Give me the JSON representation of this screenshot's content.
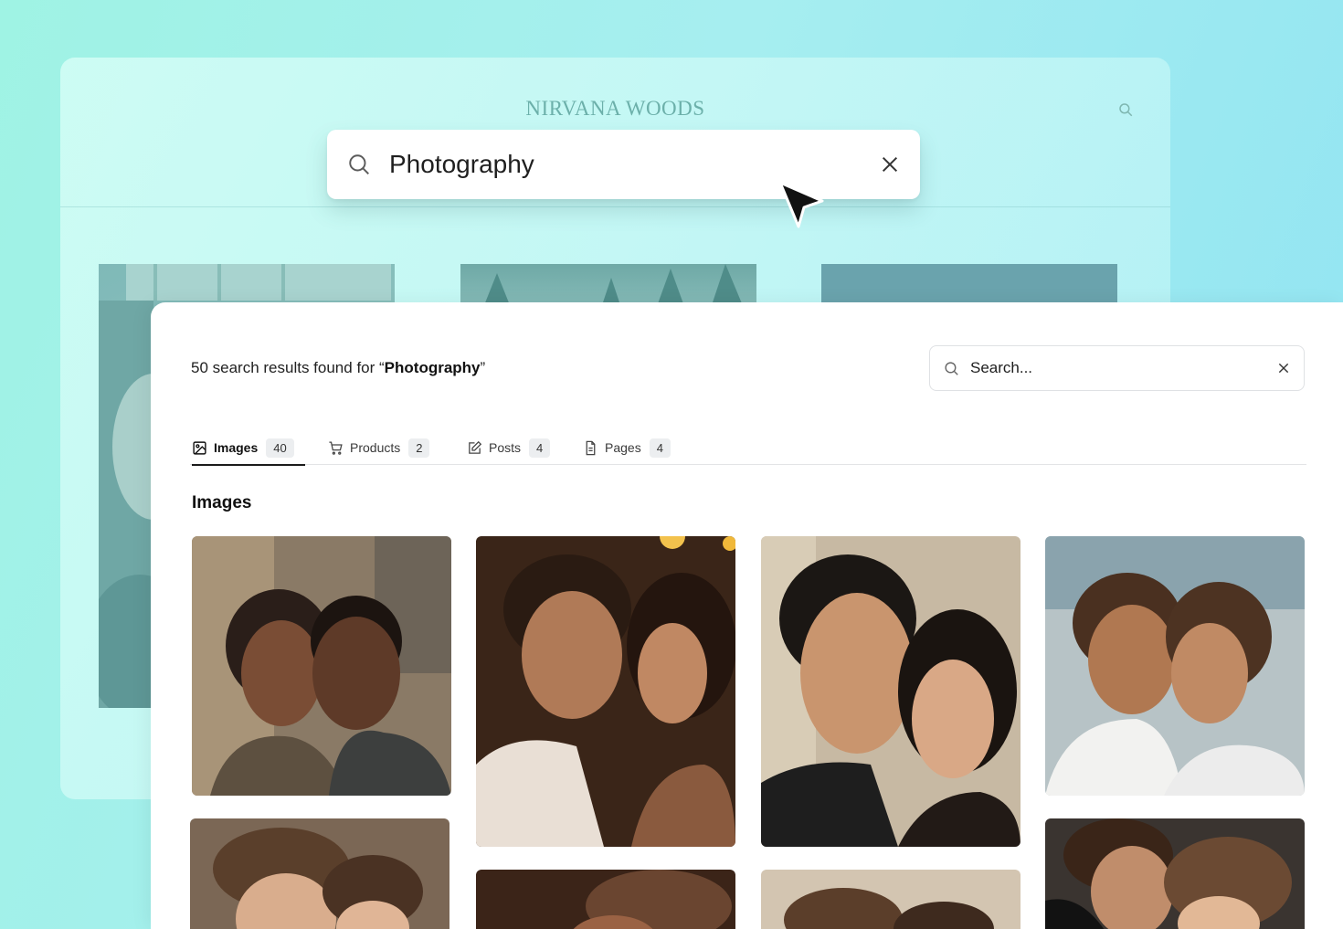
{
  "background_site": {
    "brand": "NIRVANA WOODS"
  },
  "hero_search": {
    "query": "Photography"
  },
  "results": {
    "prefix": "50 search results found for “",
    "query": "Photography",
    "suffix": "”",
    "search_placeholder": "Search..."
  },
  "tabs": [
    {
      "label": "Images",
      "count": "40",
      "icon": "image-icon",
      "active": true
    },
    {
      "label": "Products",
      "count": "2",
      "icon": "cart-icon",
      "active": false
    },
    {
      "label": "Posts",
      "count": "4",
      "icon": "edit-icon",
      "active": false
    },
    {
      "label": "Pages",
      "count": "4",
      "icon": "document-icon",
      "active": false
    }
  ],
  "section_title": "Images",
  "colors": {
    "background_start": "#9ff3e4",
    "background_end": "#8fe3f2",
    "brand": "#6cb0aa",
    "active_tab_underline": "#1b1b1b"
  }
}
